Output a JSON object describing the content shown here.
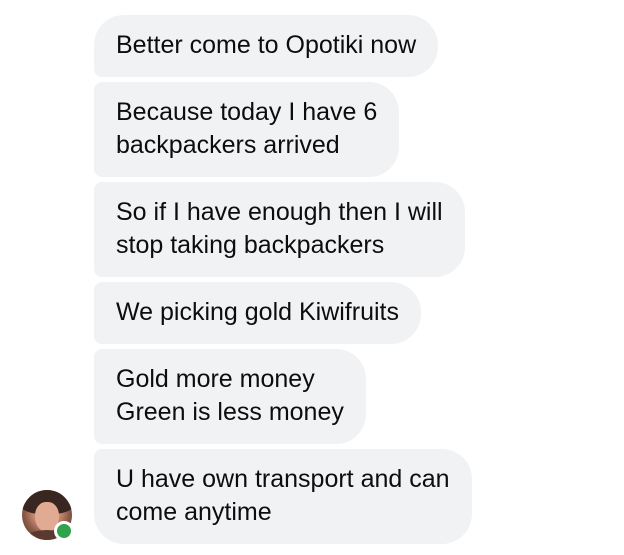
{
  "conversation": {
    "messages": [
      {
        "text": "Better come to Opotiki now"
      },
      {
        "text": "Because today I have 6\nbackpackers arrived"
      },
      {
        "text": "So if I have enough then I will\nstop taking backpackers"
      },
      {
        "text": "We picking gold Kiwifruits"
      },
      {
        "text": "Gold more money\nGreen is  less money"
      },
      {
        "text": "U have own transport and can\ncome anytime"
      }
    ],
    "sender": {
      "avatar_icon": "profile-photo",
      "online": true,
      "online_color": "#31a24c"
    }
  },
  "theme": {
    "bubble_color": "#f1f2f4",
    "text_color": "#0d0d0d",
    "background": "#ffffff"
  }
}
